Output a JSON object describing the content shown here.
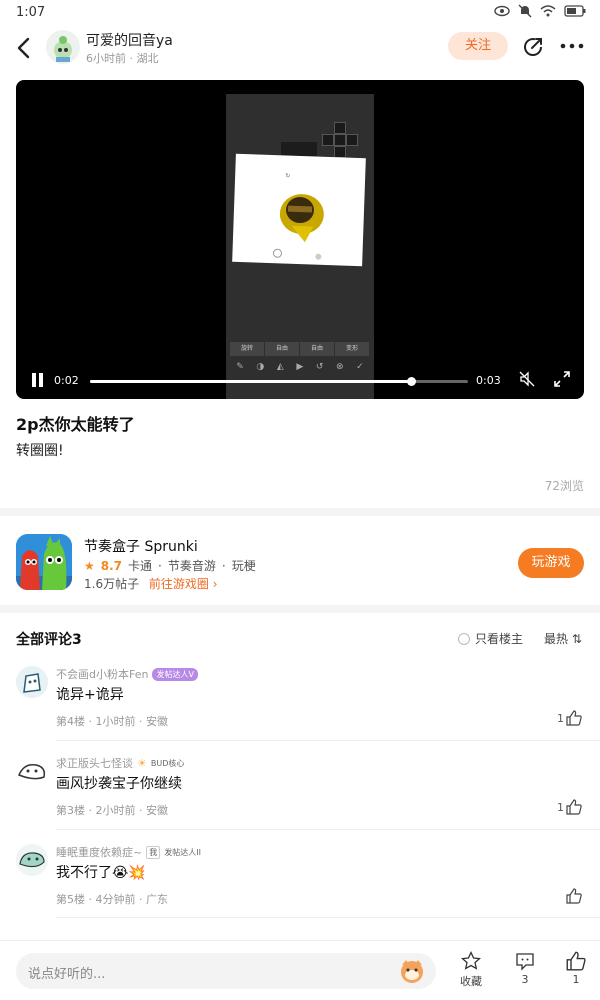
{
  "status": {
    "time": "1:07"
  },
  "header": {
    "username": "可爱的回音ya",
    "meta": "6小时前 · 湖北",
    "follow_label": "关注"
  },
  "video": {
    "current_time": "0:02",
    "duration": "0:03",
    "progress": 0.85,
    "tabs": [
      "旋转",
      "自由",
      "自由",
      "变形"
    ]
  },
  "post": {
    "title": "2p杰你太能转了",
    "body": "转圈圈!",
    "views": "72浏览"
  },
  "game": {
    "name": "节奏盒子 Sprunki",
    "score": "8.7",
    "tags": [
      "卡通",
      "节奏音游",
      "玩梗"
    ],
    "posts": "1.6万帖子",
    "link": "前往游戏圈",
    "play_label": "玩游戏"
  },
  "comments_header": {
    "title": "全部评论3",
    "owner_only": "只看楼主",
    "sort": "最热 ⇅"
  },
  "comments": [
    {
      "name": "不会画d小粉本Fen",
      "badge": "发帖达人V",
      "text": "诡异+诡异",
      "meta": "第4楼 · 1小时前 · 安徽",
      "likes": "1"
    },
    {
      "name": "求正版头七怪谈",
      "badge": "BUD核心",
      "text": "画风抄袭宝子你继续",
      "meta": "第3楼 · 2小时前 · 安徽",
      "likes": "1"
    },
    {
      "name": "睡眠重度依赖症~",
      "tag": "我",
      "badge": "发帖达人II",
      "text": "我不行了😭💥",
      "meta": "第5楼 · 4分钟前 · 广东",
      "likes": ""
    }
  ],
  "bottom": {
    "placeholder": "说点好听的...",
    "favorite_label": "收藏",
    "comment_count": "3",
    "like_count": "1"
  }
}
